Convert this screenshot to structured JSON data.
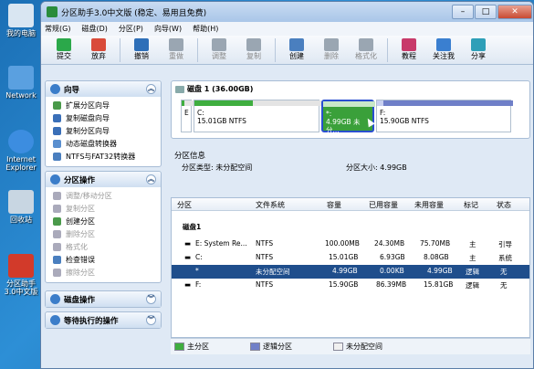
{
  "desktop": {
    "icons": [
      {
        "label": "我的电脑",
        "color": "#d9e6f2"
      },
      {
        "label": "Network",
        "color": "#5aa0e0"
      },
      {
        "label": "Internet Explorer",
        "color": "#3c8de0"
      },
      {
        "label": "回收站",
        "color": "#c8d6e2"
      },
      {
        "label": "分区助手3.0中文版",
        "color": "#d23a2a"
      }
    ]
  },
  "window": {
    "title": "分区助手3.0中文版 (稳定、易用且免费)",
    "buttons": {
      "minimize": "–",
      "maximize": "□",
      "close": "✕"
    }
  },
  "menu": [
    "常规(G)",
    "磁盘(D)",
    "分区(P)",
    "向导(W)",
    "帮助(H)"
  ],
  "toolbar": [
    {
      "label": "提交",
      "icon": "check-icon",
      "color": "#2ba84a",
      "enabled": true
    },
    {
      "label": "放弃",
      "icon": "discard-icon",
      "color": "#d94b3a",
      "enabled": true
    },
    {
      "label": "撤销",
      "icon": "undo-icon",
      "color": "#2e6fb8",
      "enabled": true
    },
    {
      "label": "重做",
      "icon": "redo-icon",
      "color": "#9aa6b2",
      "enabled": false
    },
    {
      "label": "调整",
      "icon": "resize-icon",
      "color": "#9aa6b2",
      "enabled": false
    },
    {
      "label": "复制",
      "icon": "copy-icon",
      "color": "#9aa6b2",
      "enabled": false
    },
    {
      "label": "创建",
      "icon": "create-icon",
      "color": "#4a7fbf",
      "enabled": true
    },
    {
      "label": "删除",
      "icon": "delete-icon",
      "color": "#9aa6b2",
      "enabled": false
    },
    {
      "label": "格式化",
      "icon": "format-icon",
      "color": "#9aa6b2",
      "enabled": false
    },
    {
      "label": "教程",
      "icon": "tutorial-icon",
      "color": "#c83a6a",
      "enabled": true
    },
    {
      "label": "关注我",
      "icon": "follow-icon",
      "color": "#3a7fd0",
      "enabled": true
    },
    {
      "label": "分享",
      "icon": "share-icon",
      "color": "#2e9fb8",
      "enabled": true
    }
  ],
  "left_panels": {
    "wizard": {
      "title": "向导",
      "items": [
        {
          "label": "扩展分区向导",
          "color": "#4a9a4a",
          "enabled": true
        },
        {
          "label": "复制磁盘向导",
          "color": "#3a6fb8",
          "enabled": true
        },
        {
          "label": "复制分区向导",
          "color": "#3a6fb8",
          "enabled": true
        },
        {
          "label": "动态磁盘转换器",
          "color": "#5a8fcf",
          "enabled": true
        },
        {
          "label": "NTFS与FAT32转换器",
          "color": "#4a7fbf",
          "enabled": true
        }
      ]
    },
    "partition_ops": {
      "title": "分区操作",
      "items": [
        {
          "label": "调整/移动分区",
          "color": "#aab",
          "enabled": false
        },
        {
          "label": "复制分区",
          "color": "#aab",
          "enabled": false
        },
        {
          "label": "创建分区",
          "color": "#4a9a4a",
          "enabled": true
        },
        {
          "label": "删除分区",
          "color": "#aab",
          "enabled": false
        },
        {
          "label": "格式化",
          "color": "#aab",
          "enabled": false
        },
        {
          "label": "检查错误",
          "color": "#4a7fbf",
          "enabled": true
        },
        {
          "label": "擦除分区",
          "color": "#aab",
          "enabled": false
        }
      ]
    },
    "disk_ops": {
      "title": "磁盘操作"
    },
    "pending_ops": {
      "title": "等待执行的操作"
    }
  },
  "disk_map": {
    "title": "磁盘 1 (36.00GB)",
    "partitions": [
      {
        "key": "e",
        "name": "E",
        "detail": "",
        "bar_color": "#3fae3f",
        "fill": 0.24,
        "selected": false
      },
      {
        "key": "c",
        "name": "C:",
        "detail": "15.01GB NTFS",
        "bar_color": "#3fae3f",
        "fill": 0.46,
        "selected": false
      },
      {
        "key": "u",
        "name": "*:",
        "detail": "4.99GB 未分...",
        "bar_color": "#c8e8c8",
        "fill": 1.0,
        "selected": true
      },
      {
        "key": "f",
        "name": "F:",
        "detail": "15.90GB NTFS",
        "bar_color": "#6f7fc8",
        "fill": 0.05,
        "selected": false
      }
    ]
  },
  "partition_info": {
    "title": "分区信息",
    "type_label": "分区类型: 未分配空间",
    "size_label": "分区大小: 4.99GB"
  },
  "table": {
    "headers": [
      "分区",
      "文件系统",
      "容量",
      "已用容量",
      "未用容量",
      "标记",
      "状态"
    ],
    "disk_label": "磁盘1",
    "rows": [
      {
        "partition": "E: System Re...",
        "fs": "NTFS",
        "capacity": "100.00MB",
        "used": "24.30MB",
        "free": "75.70MB",
        "flag": "主",
        "status": "引导",
        "selected": false,
        "icon": true
      },
      {
        "partition": "C:",
        "fs": "NTFS",
        "capacity": "15.01GB",
        "used": "6.93GB",
        "free": "8.08GB",
        "flag": "主",
        "status": "系统",
        "selected": false,
        "icon": true
      },
      {
        "partition": "*",
        "fs": "未分配空间",
        "capacity": "4.99GB",
        "used": "0.00KB",
        "free": "4.99GB",
        "flag": "逻辑",
        "status": "无",
        "selected": true,
        "icon": false
      },
      {
        "partition": "F:",
        "fs": "NTFS",
        "capacity": "15.90GB",
        "used": "86.39MB",
        "free": "15.81GB",
        "flag": "逻辑",
        "status": "无",
        "selected": false,
        "icon": true
      }
    ]
  },
  "legend": [
    {
      "label": "主分区",
      "color": "#3fae3f"
    },
    {
      "label": "逻辑分区",
      "color": "#6f7fc8"
    },
    {
      "label": "未分配空间",
      "color": "#f0f0f0"
    }
  ]
}
